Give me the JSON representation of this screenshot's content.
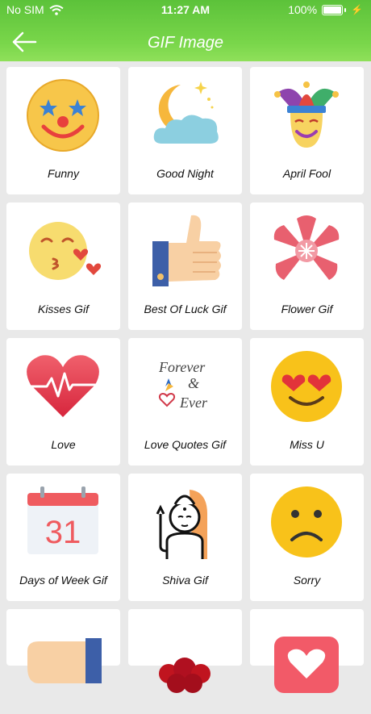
{
  "status_bar": {
    "carrier": "No SIM",
    "time": "11:27 AM",
    "battery": "100%"
  },
  "header": {
    "title": "GIF Image"
  },
  "categories": [
    {
      "label": "Funny",
      "icon": "clown-face-icon"
    },
    {
      "label": "Good Night",
      "icon": "moon-cloud-icon"
    },
    {
      "label": "April Fool",
      "icon": "jester-mask-icon"
    },
    {
      "label": "Kisses Gif",
      "icon": "kissing-face-icon"
    },
    {
      "label": "Best Of Luck Gif",
      "icon": "thumbs-up-icon"
    },
    {
      "label": "Flower Gif",
      "icon": "flower-icon"
    },
    {
      "label": "Love",
      "icon": "heartbeat-icon"
    },
    {
      "label": "Love Quotes Gif",
      "icon": "forever-and-ever-icon"
    },
    {
      "label": "Miss U",
      "icon": "heart-eyes-face-icon"
    },
    {
      "label": "Days of Week Gif",
      "icon": "calendar-icon"
    },
    {
      "label": "Shiva Gif",
      "icon": "shiva-icon"
    },
    {
      "label": "Sorry",
      "icon": "sad-face-icon"
    }
  ],
  "partial_icons": [
    "hand-icon",
    "roses-icon",
    "heart-card-icon"
  ],
  "calendar_day": "31",
  "quote_text": [
    "Forever",
    "&",
    "Ever"
  ]
}
